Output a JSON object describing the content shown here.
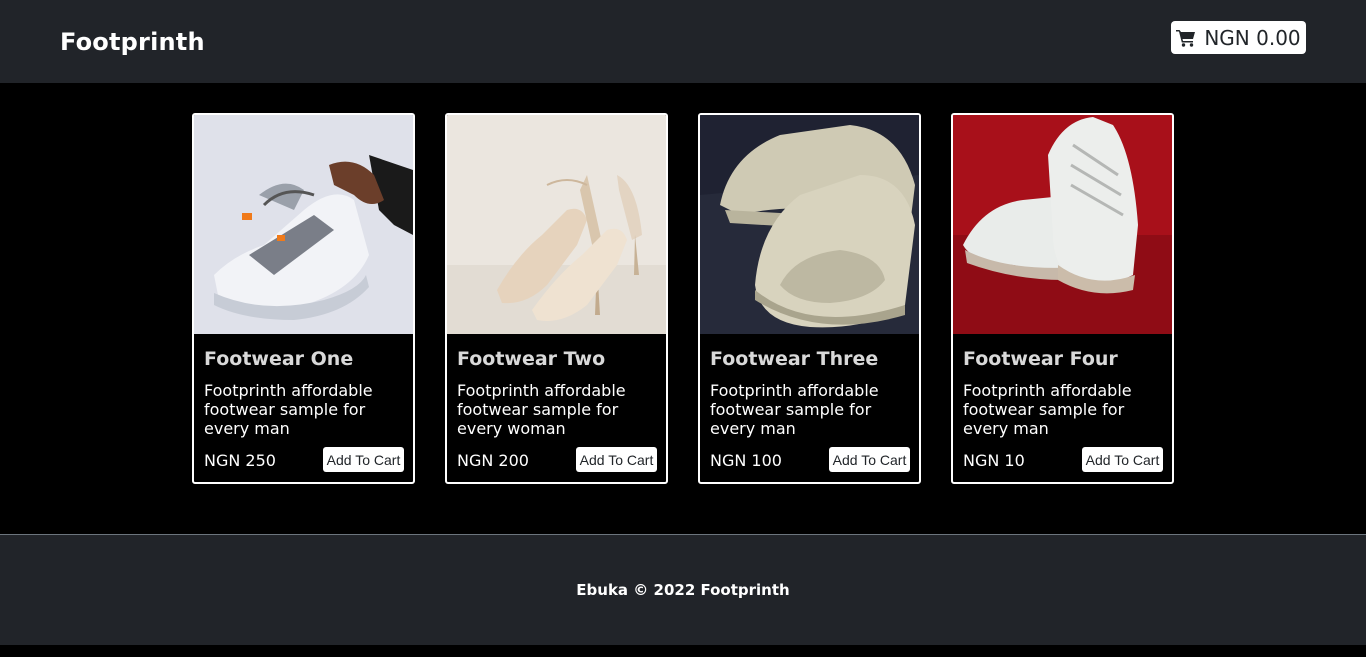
{
  "header": {
    "brand": "Footprinth",
    "cart_total": "NGN 0.00",
    "cart_icon": "cart-icon"
  },
  "products": [
    {
      "title": "Footwear One",
      "description": "Footprinth affordable footwear sample for every man",
      "price": "NGN 250",
      "button_label": "Add To Cart",
      "image": "white-sneaker-in-hand"
    },
    {
      "title": "Footwear Two",
      "description": "Footprinth affordable footwear sample for every woman",
      "price": "NGN 200",
      "button_label": "Add To Cart",
      "image": "cream-high-heels"
    },
    {
      "title": "Footwear Three",
      "description": "Footprinth affordable footwear sample for every man",
      "price": "NGN 100",
      "button_label": "Add To Cart",
      "image": "cream-slides"
    },
    {
      "title": "Footwear Four",
      "description": "Footprinth affordable footwear sample for every man",
      "price": "NGN 10",
      "button_label": "Add To Cart",
      "image": "white-sneakers-on-red"
    }
  ],
  "footer": {
    "text": "Ebuka © 2022 Footprinth"
  },
  "colors": {
    "header_bg": "#212429",
    "page_bg": "#000000",
    "card_border": "#ffffff",
    "button_bg": "#ffffff"
  }
}
